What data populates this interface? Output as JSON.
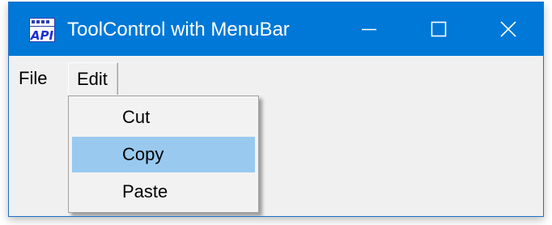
{
  "window": {
    "title": "ToolControl with MenuBar",
    "icon": "api-app-icon",
    "titlebar_color": "#0078d7",
    "controls": [
      "minimize-icon",
      "maximize-icon",
      "close-icon"
    ]
  },
  "menubar": {
    "items": [
      {
        "label": "File"
      },
      {
        "label": "Edit",
        "state": "open"
      }
    ]
  },
  "dropdown": {
    "parent": "Edit",
    "items": [
      {
        "label": "Cut"
      },
      {
        "label": "Copy",
        "highlighted": true
      },
      {
        "label": "Paste"
      }
    ],
    "highlight_color": "#99c9ef"
  }
}
